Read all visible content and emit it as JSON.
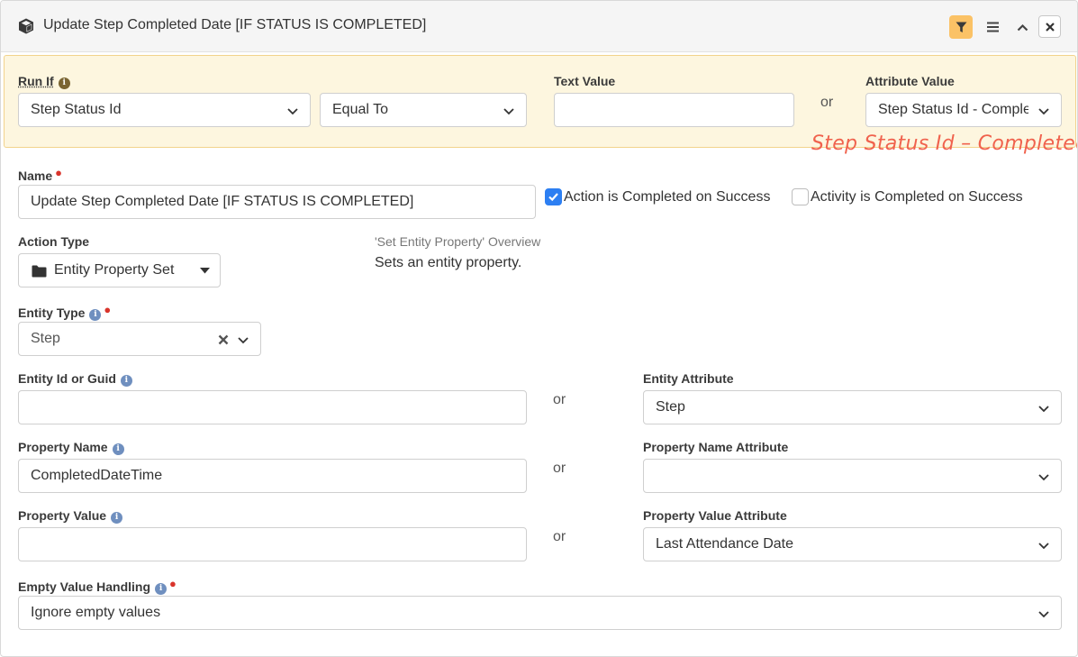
{
  "header": {
    "title": "Update Step Completed Date [IF STATUS IS COMPLETED]",
    "icons": [
      "cube-icon",
      "filter-icon",
      "menu-icon",
      "chevron-up-icon",
      "close-icon"
    ]
  },
  "run_if": {
    "label": "Run If",
    "field": "Step Status Id",
    "comparison": "Equal To",
    "text_value_label": "Text Value",
    "text_value": "",
    "or": "or",
    "attribute_value_label": "Attribute Value",
    "attribute_value": "Step Status Id - Completed"
  },
  "annotation": "Step Status Id – Completed",
  "name": {
    "label": "Name",
    "value": "Update Step Completed Date [IF STATUS IS COMPLETED]"
  },
  "checkboxes": {
    "action_completed": {
      "label": "Action is Completed on Success",
      "checked": true
    },
    "activity_completed": {
      "label": "Activity is Completed on Success",
      "checked": false
    }
  },
  "action_type": {
    "label": "Action Type",
    "value": "Entity Property Set",
    "overview_title": "'Set Entity Property' Overview",
    "overview_desc": "Sets an entity property."
  },
  "entity_type": {
    "label": "Entity Type",
    "value": "Step"
  },
  "entity_id": {
    "label": "Entity Id or Guid",
    "value": "",
    "or": "or",
    "attribute_label": "Entity Attribute",
    "attribute_value": "Step"
  },
  "property_name": {
    "label": "Property Name",
    "value": "CompletedDateTime",
    "or": "or",
    "attribute_label": "Property Name Attribute",
    "attribute_value": ""
  },
  "property_value": {
    "label": "Property Value",
    "value": "",
    "or": "or",
    "attribute_label": "Property Value Attribute",
    "attribute_value": "Last Attendance Date"
  },
  "empty_value_handling": {
    "label": "Empty Value Handling",
    "value": "Ignore empty values"
  },
  "colors": {
    "accent": "#2d7ff2",
    "filter_active": "#fbc266",
    "run_if_background": "#fdf6df",
    "required": "#d9342b",
    "annotation": "#f0624d"
  }
}
